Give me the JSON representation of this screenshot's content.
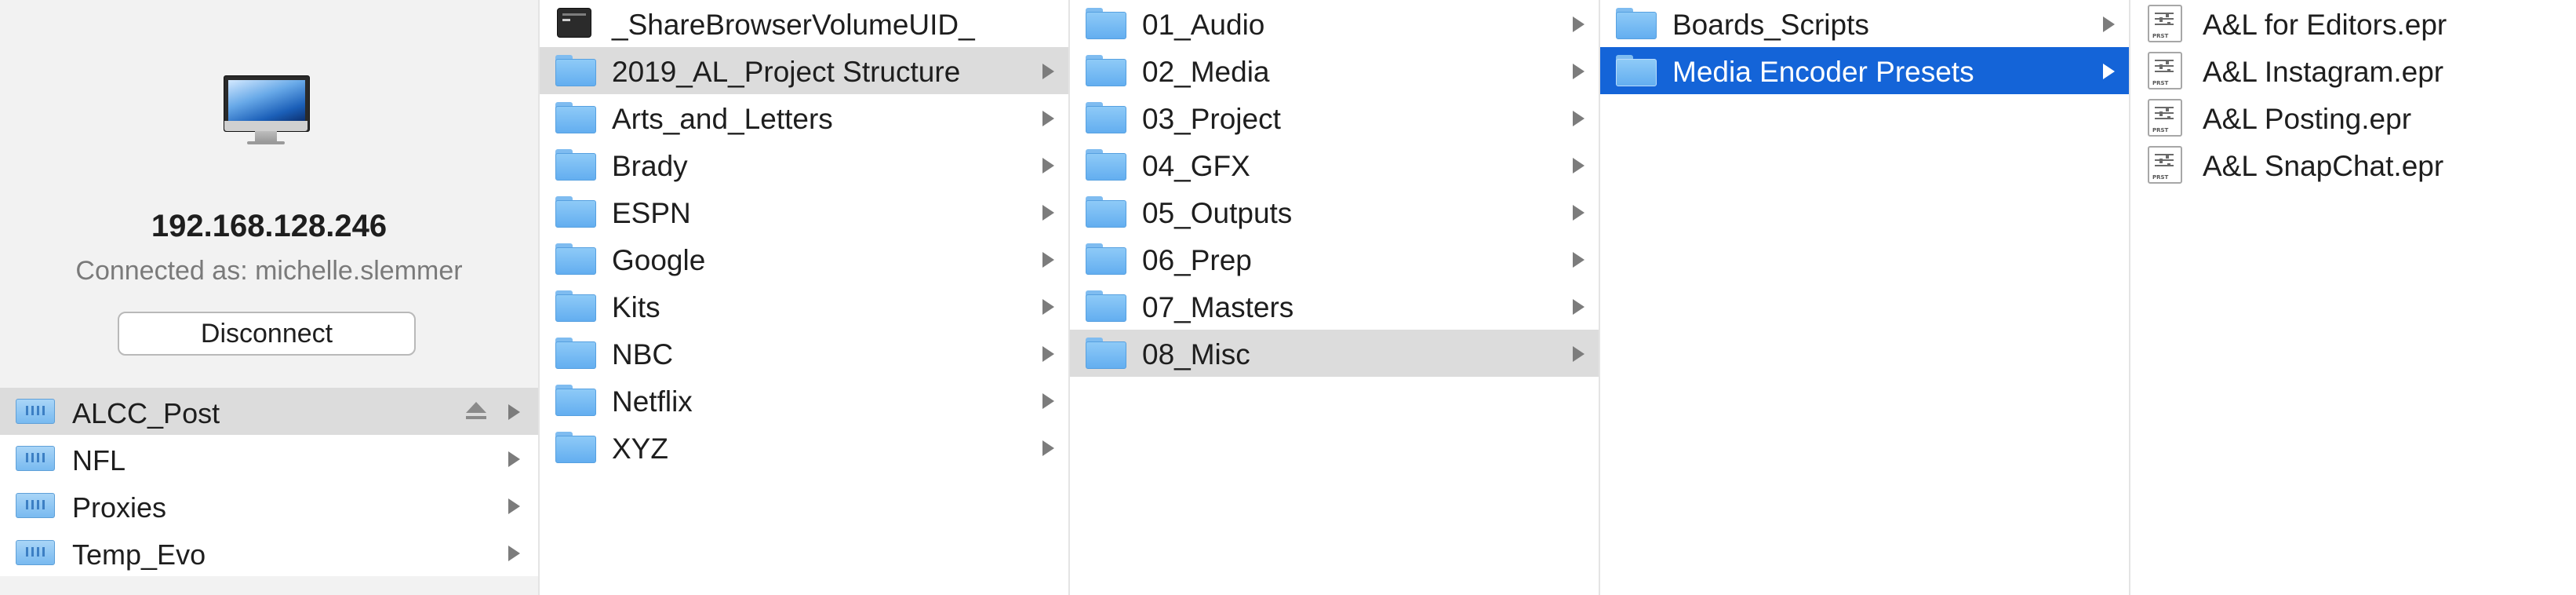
{
  "server": {
    "address": "192.168.128.246",
    "connected_as": "Connected as: michelle.slemmer",
    "disconnect_label": "Disconnect",
    "volumes": [
      {
        "label": "ALCC_Post",
        "selected": true,
        "ejectable": true
      },
      {
        "label": "NFL",
        "selected": false,
        "ejectable": false
      },
      {
        "label": "Proxies",
        "selected": false,
        "ejectable": false
      },
      {
        "label": "Temp_Evo",
        "selected": false,
        "ejectable": false
      }
    ]
  },
  "columns": {
    "alcc_post": [
      {
        "label": "_ShareBrowserVolumeUID_",
        "icon": "terminal-icon"
      },
      {
        "label": "2019_AL_Project Structure",
        "icon": "folder-icon",
        "selected": "gray"
      },
      {
        "label": "Arts_and_Letters",
        "icon": "folder-icon"
      },
      {
        "label": "Brady",
        "icon": "folder-icon"
      },
      {
        "label": "ESPN",
        "icon": "folder-icon"
      },
      {
        "label": "Google",
        "icon": "folder-icon"
      },
      {
        "label": "Kits",
        "icon": "folder-icon"
      },
      {
        "label": "NBC",
        "icon": "folder-icon"
      },
      {
        "label": "Netflix",
        "icon": "folder-icon"
      },
      {
        "label": "XYZ",
        "icon": "folder-icon"
      }
    ],
    "project_structure": [
      {
        "label": "01_Audio",
        "icon": "folder-icon"
      },
      {
        "label": "02_Media",
        "icon": "folder-icon"
      },
      {
        "label": "03_Project",
        "icon": "folder-icon"
      },
      {
        "label": "04_GFX",
        "icon": "folder-icon"
      },
      {
        "label": "05_Outputs",
        "icon": "folder-icon"
      },
      {
        "label": "06_Prep",
        "icon": "folder-icon"
      },
      {
        "label": "07_Masters",
        "icon": "folder-icon"
      },
      {
        "label": "08_Misc",
        "icon": "folder-icon",
        "selected": "gray"
      }
    ],
    "misc": [
      {
        "label": "Boards_Scripts",
        "icon": "folder-icon"
      },
      {
        "label": "Media Encoder Presets",
        "icon": "folder-icon",
        "selected": "blue"
      }
    ],
    "presets": [
      {
        "label": "A&L for Editors.epr",
        "icon": "preset-file-icon"
      },
      {
        "label": "A&L Instagram.epr",
        "icon": "preset-file-icon"
      },
      {
        "label": "A&L Posting.epr",
        "icon": "preset-file-icon"
      },
      {
        "label": "A&L SnapChat.epr",
        "icon": "preset-file-icon"
      }
    ]
  },
  "colors": {
    "selection_blue": "#1464d8",
    "selection_gray": "#dcdcdc",
    "folder_blue": "#63aef0"
  }
}
